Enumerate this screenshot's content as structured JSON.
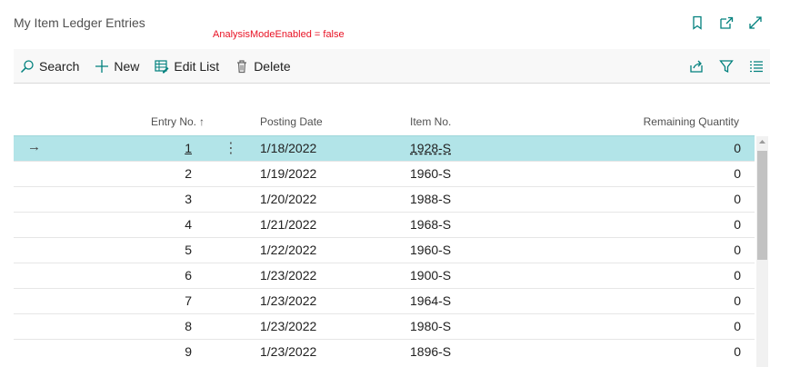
{
  "page": {
    "title": "My Item Ledger Entries",
    "analysis_note": "AnalysisModeEnabled = false"
  },
  "header_icons": [
    "bookmark-icon",
    "open-new-window-icon",
    "expand-icon"
  ],
  "actions": {
    "search": "Search",
    "new": "New",
    "edit_list": "Edit List",
    "delete": "Delete"
  },
  "actions_right_icons": [
    "share-icon",
    "filter-icon",
    "list-view-icon"
  ],
  "columns": {
    "entry_no": "Entry No.",
    "posting_date": "Posting Date",
    "item_no": "Item No.",
    "remaining_quantity": "Remaining Quantity"
  },
  "sort": {
    "column": "entry_no",
    "direction": "ascending",
    "glyph": "↑"
  },
  "row_markers": {
    "arrow": "→",
    "menu": "⋮"
  },
  "rows": [
    {
      "entry_no": "1",
      "posting_date": "1/18/2022",
      "item_no": "1928-S",
      "remaining_quantity": "0",
      "selected": true
    },
    {
      "entry_no": "2",
      "posting_date": "1/19/2022",
      "item_no": "1960-S",
      "remaining_quantity": "0"
    },
    {
      "entry_no": "3",
      "posting_date": "1/20/2022",
      "item_no": "1988-S",
      "remaining_quantity": "0"
    },
    {
      "entry_no": "4",
      "posting_date": "1/21/2022",
      "item_no": "1968-S",
      "remaining_quantity": "0"
    },
    {
      "entry_no": "5",
      "posting_date": "1/22/2022",
      "item_no": "1960-S",
      "remaining_quantity": "0"
    },
    {
      "entry_no": "6",
      "posting_date": "1/23/2022",
      "item_no": "1900-S",
      "remaining_quantity": "0"
    },
    {
      "entry_no": "7",
      "posting_date": "1/23/2022",
      "item_no": "1964-S",
      "remaining_quantity": "0"
    },
    {
      "entry_no": "8",
      "posting_date": "1/23/2022",
      "item_no": "1980-S",
      "remaining_quantity": "0"
    },
    {
      "entry_no": "9",
      "posting_date": "1/23/2022",
      "item_no": "1896-S",
      "remaining_quantity": "0"
    }
  ],
  "colors": {
    "accent": "#00807d",
    "selected_row": "#b2e4e8",
    "note_red": "#e81123"
  }
}
